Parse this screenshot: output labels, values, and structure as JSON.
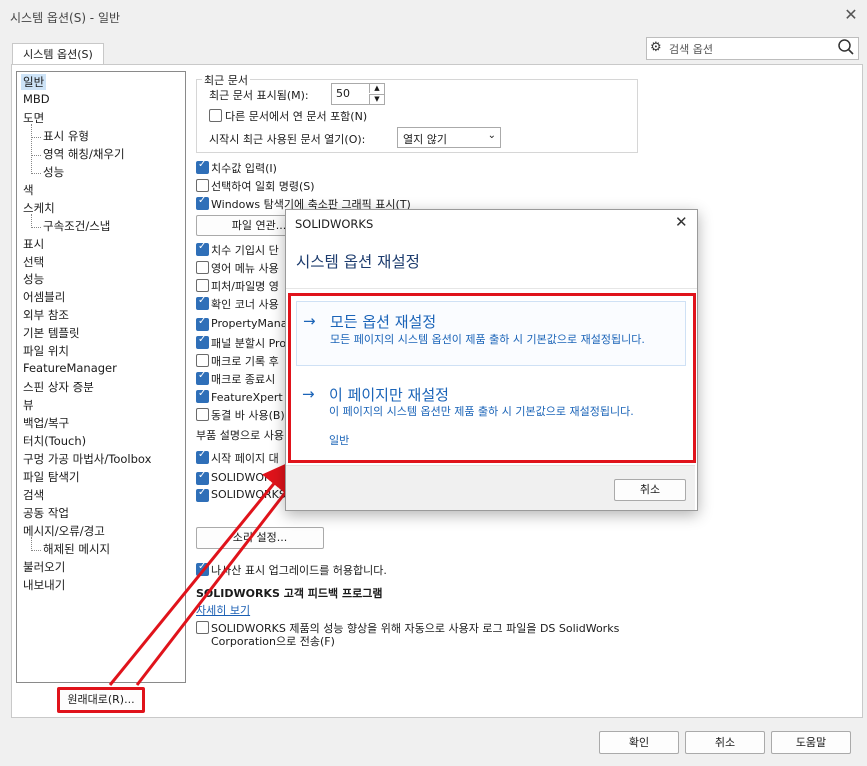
{
  "window": {
    "title": "시스템 옵션(S) - 일반",
    "close_glyph": "✕"
  },
  "tab_label": "시스템 옵션(S)",
  "search": {
    "placeholder": "검색 옵션",
    "icon_left": "gear-icon",
    "icon_right": "search-icon"
  },
  "nav": {
    "items": [
      {
        "label": "일반",
        "selected": true
      },
      {
        "label": "MBD"
      },
      {
        "label": "도면"
      },
      {
        "label": "표시 유형",
        "sub": true
      },
      {
        "label": "영역 해칭/채우기",
        "sub": true
      },
      {
        "label": "성능",
        "sub": true
      },
      {
        "label": "색"
      },
      {
        "label": "스케치"
      },
      {
        "label": "구속조건/스냅",
        "sub": true
      },
      {
        "label": "표시"
      },
      {
        "label": "선택"
      },
      {
        "label": "성능"
      },
      {
        "label": "어셈블리"
      },
      {
        "label": "외부 참조"
      },
      {
        "label": "기본 템플릿"
      },
      {
        "label": "파일 위치"
      },
      {
        "label": "FeatureManager"
      },
      {
        "label": "스핀 상자 증분"
      },
      {
        "label": "뷰"
      },
      {
        "label": "백업/복구"
      },
      {
        "label": "터치(Touch)"
      },
      {
        "label": "구멍 가공 마법사/Toolbox"
      },
      {
        "label": "파일 탐색기"
      },
      {
        "label": "검색"
      },
      {
        "label": "공동 작업"
      },
      {
        "label": "메시지/오류/경고"
      },
      {
        "label": "해제된 메시지",
        "sub": true
      },
      {
        "label": "불러오기"
      },
      {
        "label": "내보내기"
      }
    ]
  },
  "reset_button": "원래대로(R)...",
  "recent": {
    "group_title": "최근 문서",
    "max_label": "최근 문서 표시됨(M):",
    "max_value": "50",
    "other_label": "다른 문서에서 연 문서 포함(N)",
    "open_label": "시작시 최근 사용된 문서 열기(O):",
    "open_value": "열지 않기"
  },
  "options": {
    "o1": "치수값 입력(I)",
    "o2": "선택하여 일회 명령(S)",
    "o3": "Windows 탐색기에 축소판 그래픽 표시(T)",
    "file_btn": "파일 연관...",
    "o4": "치수 기입시 단",
    "o5": "영어 메뉴 사용",
    "o6": "피처/파일명 영",
    "o7": "확인 코너 사용",
    "o8": "PropertyMana",
    "o9": "패널 분할시 Pro",
    "o10": "매크로 기록 후",
    "o11": "매크로 종료시",
    "o12": "FeatureXpert 시",
    "o13": "동결 바 사용(B)",
    "parts_label": "부품 설명으로 사용",
    "o14": "시작 페이지 대",
    "o15": "SOLIDWORKS",
    "o16": "SOLIDWORKS",
    "sound_btn": "소리 설정...",
    "o17": "나사산 표시 업그레이드를 허용합니다.",
    "feedback_title": "SOLIDWORKS 고객 피드백 프로그램",
    "more_link": "자세히 보기",
    "o18_line1": "SOLIDWORKS 제품의 성능 향상을 위해 자동으로 사용자 로그 파일을 DS SolidWorks",
    "o18_line2": "Corporation으로 전송(F)"
  },
  "dialog": {
    "title": "SOLIDWORKS",
    "heading": "시스템 옵션 재설정",
    "opt1_title": "모든 옵션 재설정",
    "opt1_desc": "모든 페이지의 시스템 옵션이 제품 출하 시 기본값으로 재설정됩니다.",
    "opt2_title": "이 페이지만 재설정",
    "opt2_desc": "이 페이지의 시스템 옵션만 제품 출하 시 기본값으로 재설정됩니다.",
    "opt2_page": "일반",
    "arrow": "→",
    "cancel": "취소"
  },
  "footer": {
    "ok": "확인",
    "cancel": "취소",
    "help": "도움말"
  },
  "colors": {
    "accent": "#1b64b8",
    "highlight": "#e0131b",
    "check": "#2f6fb8"
  }
}
